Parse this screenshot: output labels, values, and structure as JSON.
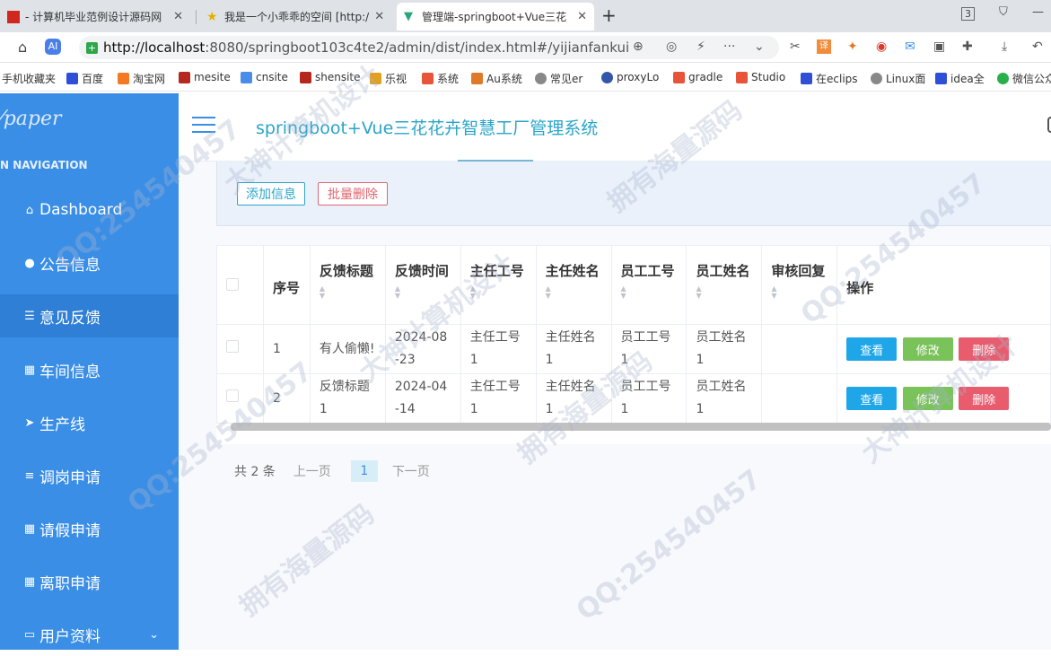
{
  "browser": {
    "tabs": [
      {
        "title": "- 计算机毕业范例设计源码网",
        "active": false
      },
      {
        "title": "我是一个小乖乖的空间 [http:/",
        "active": false
      },
      {
        "title": "管理端-springboot+Vue三花",
        "active": true
      }
    ],
    "tab_counter": "3",
    "url_host": "http://localhost",
    "url_path": ":8080/springboot103c4te2/admin/dist/index.html#/yijianfankui",
    "bookmarks": [
      "手机收藏夹",
      "百度",
      "淘宝网",
      "mesite",
      "cnsite",
      "shensite",
      "乐视",
      "系统",
      "Au系统",
      "常见er",
      "proxyLo",
      "gradle",
      "Studio",
      "在eclips",
      "Linux面",
      "idea全",
      "微信公众"
    ]
  },
  "app": {
    "logo": "paper",
    "nav_heading": "N NAVIGATION",
    "title": "springboot+Vue三花花卉智慧工厂管理系统",
    "menu": [
      {
        "label": "Dashboard",
        "icon": "home-icon"
      },
      {
        "label": "公告信息",
        "icon": "bulb-icon"
      },
      {
        "label": "意见反馈",
        "icon": "list-icon"
      },
      {
        "label": "车间信息",
        "icon": "grid-icon"
      },
      {
        "label": "生产线",
        "icon": "send-icon"
      },
      {
        "label": "调岗申请",
        "icon": "sliders-icon"
      },
      {
        "label": "请假申请",
        "icon": "grid-icon"
      },
      {
        "label": "离职申请",
        "icon": "grid-icon"
      },
      {
        "label": "用户资料",
        "icon": "card-icon"
      }
    ]
  },
  "toolbar": {
    "add_label": "添加信息",
    "batch_delete_label": "批量删除"
  },
  "table": {
    "headers": [
      "序号",
      "反馈标题",
      "反馈时间",
      "主任工号",
      "主任姓名",
      "员工工号",
      "员工姓名",
      "审核回复",
      "操作"
    ],
    "rows": [
      {
        "index": "1",
        "title": "有人偷懒!",
        "time": "2024-08-23",
        "director_no": "主任工号1",
        "director_name": "主任姓名1",
        "staff_no": "员工工号1",
        "staff_name": "员工姓名1",
        "reply": ""
      },
      {
        "index": "2",
        "title": "反馈标题1",
        "time": "2024-04-14",
        "director_no": "主任工号1",
        "director_name": "主任姓名1",
        "staff_no": "员工工号1",
        "staff_name": "员工姓名1",
        "reply": ""
      }
    ],
    "actions": {
      "view": "查看",
      "edit": "修改",
      "delete": "删除"
    }
  },
  "pagination": {
    "total": "共 2 条",
    "prev": "上一页",
    "current": "1",
    "next": "下一页"
  },
  "watermarks": [
    "拥有海量源码",
    "QQ:254540457",
    "大神计算机设计"
  ]
}
